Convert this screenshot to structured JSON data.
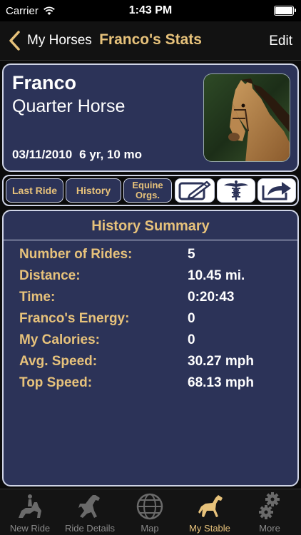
{
  "status_bar": {
    "carrier": "Carrier",
    "time": "1:43 PM"
  },
  "nav": {
    "back_label": "My Horses",
    "title": "Franco's Stats",
    "edit_label": "Edit"
  },
  "horse": {
    "name": "Franco",
    "breed": "Quarter Horse",
    "birthdate": "03/11/2010",
    "age": "6 yr, 10 mo"
  },
  "toolbar": {
    "last_ride_label": "Last Ride",
    "history_label": "History",
    "equine_line1": "Equine",
    "equine_line2": "Orgs.",
    "icons": [
      "edit-icon",
      "caduceus-icon",
      "share-icon"
    ]
  },
  "summary": {
    "title": "History Summary",
    "rows": [
      {
        "label": "Number of Rides:",
        "value": "5"
      },
      {
        "label": "Distance:",
        "value": "10.45 mi."
      },
      {
        "label": "Time:",
        "value": "0:20:43"
      },
      {
        "label": "Franco's Energy:",
        "value": "0"
      },
      {
        "label": "My Calories:",
        "value": "0"
      },
      {
        "label": "Avg. Speed:",
        "value": "30.27 mph"
      },
      {
        "label": "Top Speed:",
        "value": "68.13 mph"
      }
    ]
  },
  "tabs": [
    {
      "label": "New Ride",
      "icon": "rider-icon",
      "active": false
    },
    {
      "label": "Ride Details",
      "icon": "rearing-horse-icon",
      "active": false
    },
    {
      "label": "Map",
      "icon": "globe-icon",
      "active": false
    },
    {
      "label": "My Stable",
      "icon": "horse-icon",
      "active": true
    },
    {
      "label": "More",
      "icon": "gears-icon",
      "active": false
    }
  ],
  "colors": {
    "accent": "#e7c27b",
    "panel": "#2c3358",
    "border": "#cfd4e6",
    "background": "#0b0b0b"
  }
}
